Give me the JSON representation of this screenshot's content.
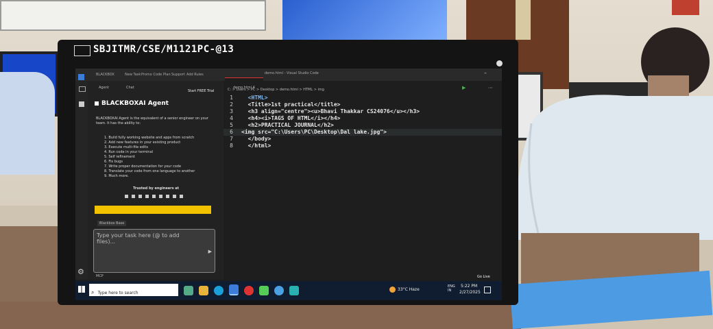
{
  "sticker": {
    "text": "SBJITMR/CSE/M1121PC-@13"
  },
  "vscode": {
    "window_title": "demo.html - Visual Studio Code",
    "menu": [
      "BLACKBOX",
      "New Task",
      "Promo Code",
      "Plan",
      "Support",
      "Add Rules"
    ],
    "tab_label": "demo.html 4",
    "breadcrumb": "C: > Users > PC > Desktop > demo.html > HTML > img",
    "sidebar": {
      "tabs": [
        "Agent",
        "Chat"
      ],
      "start_button": "Start FREE Trial",
      "heading": "BLACKBOXAI Agent",
      "intro": "BLACKBOXAI Agent is the equivalent of a senior engineer on your team. It has the ability to:",
      "abilities": [
        "1. Build fully working website and apps from scratch",
        "2. Add new features in your existing product",
        "3. Execute multi-file edits",
        "4. Run code in your terminal",
        "5. Self refinement",
        "6. Fix bugs",
        "7. Write proper documentation for your code",
        "8. Translate your code from one language to another",
        "9. Much more."
      ],
      "trusted": "Trusted by engineers at",
      "model_select": "Blackbox Base",
      "task_placeholder": "Type your task here (@ to add files)...",
      "mcp_label": "MCP"
    },
    "editor": {
      "lines": [
        {
          "n": "1",
          "text": "  <HTML>"
        },
        {
          "n": "2",
          "text": "  <Title>1st practical</title>"
        },
        {
          "n": "3",
          "text": "  <h3 align=\"centre\"><u>Bhavi Thakkar CS24076</u></h3>"
        },
        {
          "n": "4",
          "text": "  <h4><i>TAGS OF HTML</i></h4>"
        },
        {
          "n": "5",
          "text": "  <h2>PRACTICAL JOURNAL</h2>"
        },
        {
          "n": "6",
          "text": "<img src=\"C:\\Users\\PC\\Desktop\\Dal lake.jpg\">"
        },
        {
          "n": "7",
          "text": "  </body>"
        },
        {
          "n": "8",
          "text": "  </html>"
        }
      ]
    },
    "status": {
      "go_live": "Go Live"
    }
  },
  "taskbar": {
    "search_placeholder": "Type here to search",
    "weather": "33°C Haze",
    "lang": "ENG\nIN",
    "time": "5:22 PM",
    "date": "2/27/2025"
  },
  "colors": {
    "accent_blue": "#3b7dd8",
    "banner_yellow": "#f2c200",
    "taskbar": "#101c30"
  }
}
